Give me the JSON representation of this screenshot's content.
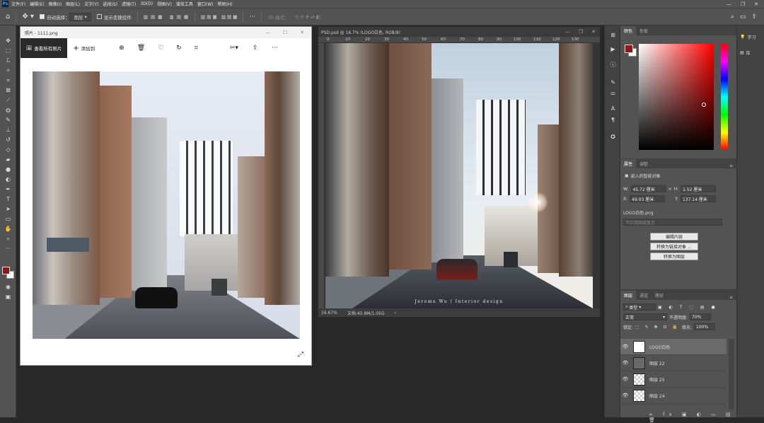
{
  "menubar": {
    "items": [
      "文件(F)",
      "编辑(E)",
      "图像(I)",
      "图层(L)",
      "文字(Y)",
      "选择(S)",
      "滤镜(T)",
      "3D(D)",
      "视图(V)",
      "增效工具",
      "窗口(W)",
      "帮助(H)"
    ]
  },
  "options": {
    "auto_select": "自动选择：",
    "layer_select": "图层",
    "show_transform": "显示变换控件",
    "mode_3d": "3D 模式："
  },
  "photos": {
    "title": "照片 - 1111.png",
    "view_all": "查看所有照片",
    "add_to": "添加到",
    "more": "···"
  },
  "document": {
    "tab_title": "PSD.psd @ 16.7% (LOGO白色, RGB/8)",
    "zoom": "16.67%",
    "doc_size": "文档:45.8M/1.05G",
    "watermark": "Jerome Wu / Interior design",
    "ruler_h": [
      "0",
      "10",
      "20",
      "30",
      "40",
      "50",
      "60",
      "70",
      "80",
      "90",
      "100",
      "110",
      "120",
      "130"
    ],
    "ruler_v": [
      "0",
      "1",
      "2",
      "3",
      "4",
      "5",
      "6",
      "7",
      "8",
      "9",
      "10",
      "11",
      "12",
      "13"
    ]
  },
  "color_panel": {
    "tabs": [
      "颜色",
      "色板"
    ],
    "fg_color": "#8b1a1a",
    "bg_color": "#ffffff"
  },
  "properties": {
    "tabs": [
      "属性",
      "调整"
    ],
    "type": "嵌入的智能对象",
    "w_label": "W:",
    "w": "45.72 厘米",
    "h_label": "H:",
    "h": "1.52 厘米",
    "x_label": "X:",
    "x": "49.03 厘米",
    "y_label": "Y:",
    "y": "137.14 厘米",
    "file": "LOGO白色.png",
    "comp_placeholder": "不应用图层复合",
    "btn_edit": "编辑内容",
    "btn_convert_linked": "转换为链接对象 ...",
    "btn_convert_layers": "转换为图层"
  },
  "layers": {
    "tabs": [
      "图层",
      "通道",
      "路径"
    ],
    "kind": "类型",
    "blend": "正常",
    "opacity_label": "不透明度:",
    "opacity": "70%",
    "lock_label": "锁定:",
    "fill_label": "填充:",
    "fill": "100%",
    "items": [
      "LOGO白色",
      "图层 22",
      "图层 25",
      "图层 24"
    ]
  },
  "right_strip": {
    "learn": "学习",
    "libraries": "库"
  }
}
